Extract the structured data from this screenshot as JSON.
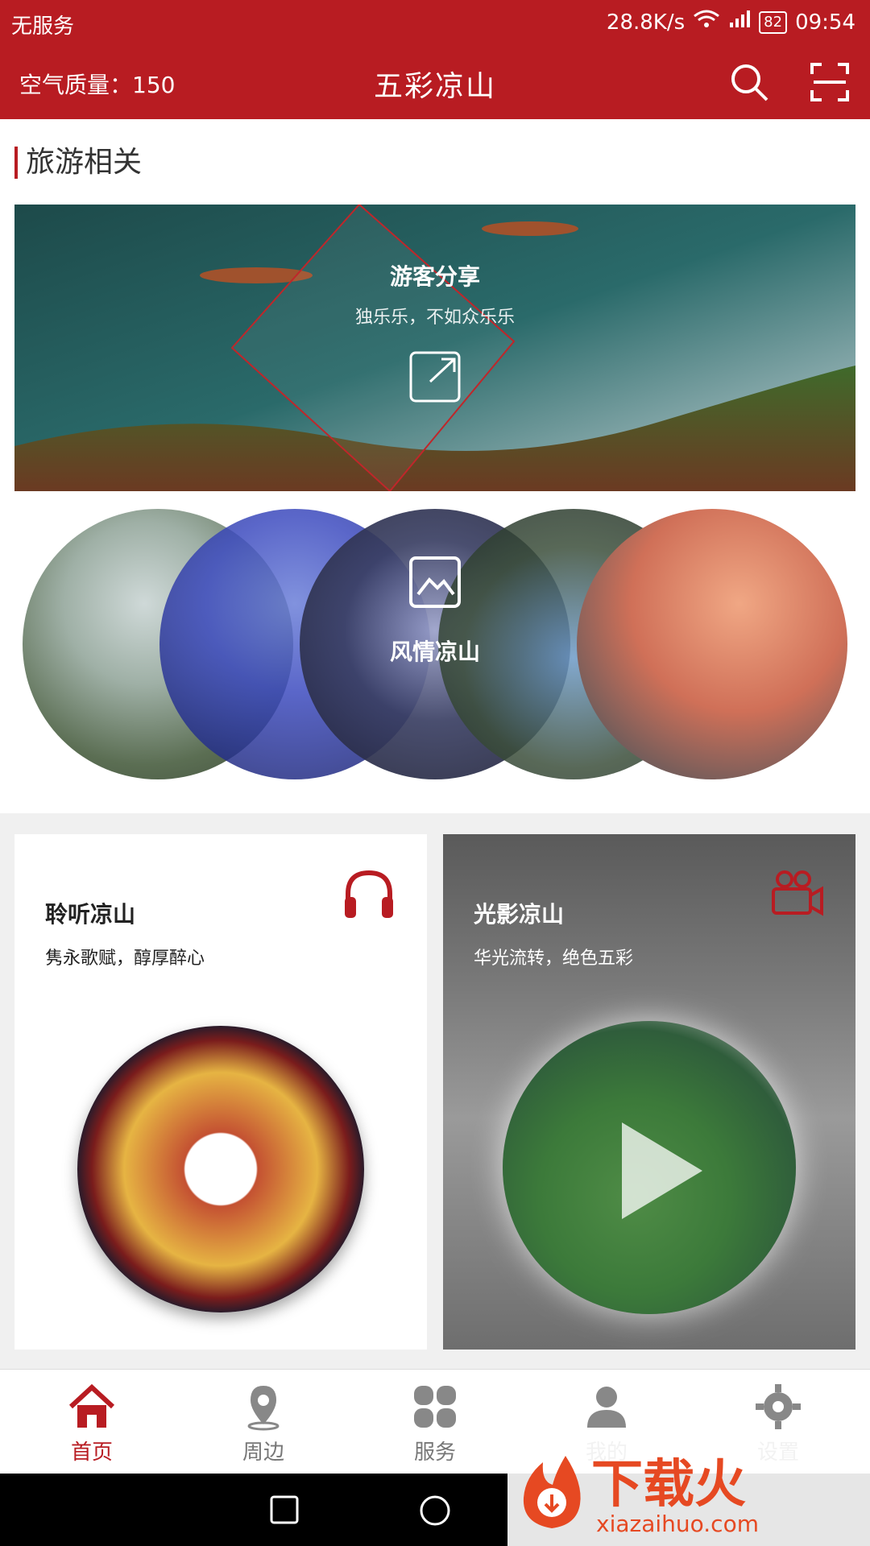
{
  "status": {
    "carrier": "无服务",
    "speed": "28.8K/s",
    "battery": "82",
    "time": "09:54"
  },
  "header": {
    "air_quality": "空气质量：150",
    "title": "五彩凉山"
  },
  "section": {
    "title": "旅游相关"
  },
  "banner": {
    "title": "游客分享",
    "subtitle": "独乐乐，不如众乐乐"
  },
  "circles": {
    "label": "风情凉山"
  },
  "cards": [
    {
      "title": "聆听凉山",
      "subtitle": "隽永歌赋，醇厚醉心"
    },
    {
      "title": "光影凉山",
      "subtitle": "华光流转，绝色五彩"
    }
  ],
  "tabs": [
    {
      "label": "首页"
    },
    {
      "label": "周边"
    },
    {
      "label": "服务"
    },
    {
      "label": "我的"
    },
    {
      "label": "设置"
    }
  ],
  "watermark": {
    "brand": "下载火",
    "url": "xiazaihuo.com"
  },
  "colors": {
    "brand_red": "#b81c22",
    "tab_inactive": "#777777"
  }
}
